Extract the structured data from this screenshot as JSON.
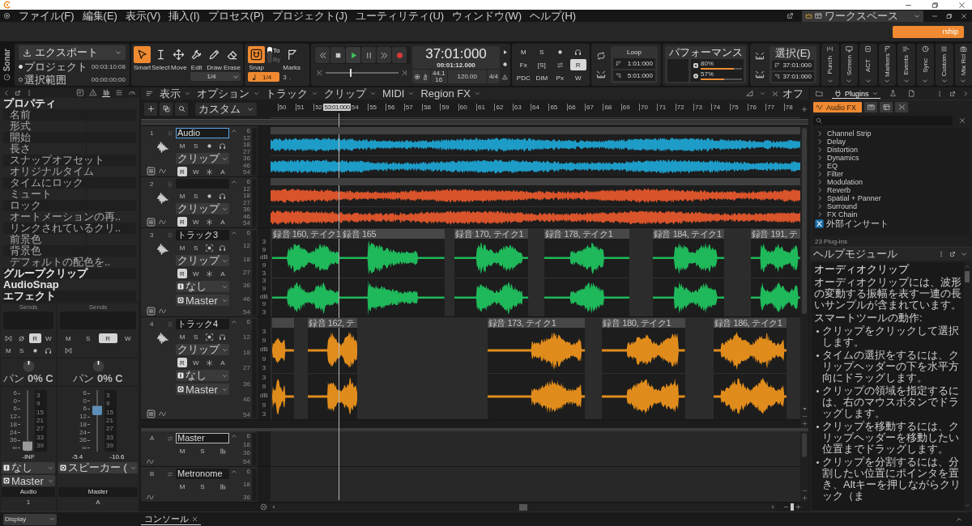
{
  "window": {
    "menu": [
      "ファイル(F)",
      "編集(E)",
      "表示(V)",
      "挿入(I)",
      "プロセス(P)",
      "プロジェクト(J)",
      "ユーティリティ(U)",
      "ウィンドウ(W)",
      "ヘルプ(H)"
    ],
    "workspace": "ワークスペース",
    "account_button": "rship"
  },
  "control_bar": {
    "logo": "Sonar",
    "export": {
      "button": "エクスポート",
      "ranges": [
        {
          "label": "プロジェクト",
          "time": "00:03:10:08",
          "selected": true
        },
        {
          "label": "選択範囲",
          "time": "00:00:00:00",
          "selected": false
        }
      ]
    },
    "tools": {
      "items": [
        {
          "kind": "smart",
          "label": "Smart",
          "selected": true
        },
        {
          "kind": "select",
          "label": "Select",
          "selected": false
        },
        {
          "kind": "move",
          "label": "Move",
          "selected": false
        },
        {
          "kind": "edit",
          "label": "Edit",
          "selected": false
        },
        {
          "kind": "draw",
          "label": "Draw",
          "selected": false
        },
        {
          "kind": "erase",
          "label": "Erase",
          "selected": false
        }
      ],
      "resolution": "1/4"
    },
    "snap": {
      "label": "Snap",
      "on": true,
      "modes": [
        {
          "label": "To",
          "selected": true
        },
        {
          "label": "By",
          "selected": false
        }
      ],
      "marks": "Marks",
      "value": "1/4",
      "modifiers": [
        "3",
        "."
      ]
    },
    "transport": {
      "buttons": [
        {
          "kind": "rewind",
          "on": false
        },
        {
          "kind": "stop",
          "on": false
        },
        {
          "kind": "play",
          "on": true
        },
        {
          "kind": "pause",
          "on": false
        },
        {
          "kind": "fast-forward",
          "on": false
        },
        {
          "kind": "record",
          "on": false
        }
      ],
      "position": {
        "level": 0.33
      },
      "time": "37:01:000",
      "time_secondary": "00:01:12.000",
      "sample_rate": "44.1",
      "bit_depth": "16",
      "tempo": "120.00",
      "meter": "4/4"
    },
    "mix": [
      {
        "kind": "text",
        "label": "M",
        "on": false
      },
      {
        "kind": "text",
        "label": "S",
        "on": false
      },
      {
        "kind": "record",
        "on": false
      },
      {
        "kind": "headphones",
        "on": false
      },
      {
        "kind": "text",
        "label": "Fx",
        "on": false
      },
      {
        "kind": "text",
        "label": "[S]",
        "on": false
      },
      {
        "kind": "swap",
        "on": false
      },
      {
        "kind": "text",
        "label": "R",
        "on": true
      },
      {
        "kind": "text",
        "label": "PDC",
        "on": false
      },
      {
        "kind": "text",
        "label": "DIM",
        "on": false
      },
      {
        "kind": "text",
        "label": "Px",
        "on": false
      },
      {
        "kind": "text",
        "label": "W",
        "on": false
      }
    ],
    "loop": {
      "title": "Loop",
      "start": "1:01:000",
      "end": "5:01:000"
    },
    "performance": {
      "title": "パフォーマンス",
      "meters": [
        {
          "reading": "80%",
          "level": 0.8
        },
        {
          "reading": "57%",
          "level": 0.57
        }
      ]
    },
    "selection": {
      "title": "選択(E)",
      "start": "37:01:000",
      "end": "37:01:000"
    },
    "views": [
      "Punch",
      "Screen",
      "ACT",
      "Markers",
      "Events",
      "Sync",
      "Custom",
      "Mix Rcl"
    ]
  },
  "inspector": {
    "tabs": [
      {
        "kind": "text-box",
        "selected": false
      },
      {
        "kind": "warning",
        "selected": false
      },
      {
        "kind": "bars",
        "selected": true
      },
      {
        "kind": "list",
        "selected": false
      },
      {
        "kind": "gauge",
        "selected": false
      }
    ],
    "properties": [
      {
        "kind": "header",
        "label": "プロパティ"
      },
      {
        "kind": "field",
        "label": "名前"
      },
      {
        "kind": "field",
        "label": "形式"
      },
      {
        "kind": "field",
        "label": "開始"
      },
      {
        "kind": "field",
        "label": "長さ"
      },
      {
        "kind": "field",
        "label": "スナップオフセット"
      },
      {
        "kind": "field",
        "label": "オリジナルタイム"
      },
      {
        "kind": "field",
        "label": "タイムにロック"
      },
      {
        "kind": "field",
        "label": "ミュート"
      },
      {
        "kind": "field",
        "label": "ロック"
      },
      {
        "kind": "field",
        "label": "オートメーションの再.."
      },
      {
        "kind": "field",
        "label": "リンクされているクリ.."
      },
      {
        "kind": "field",
        "label": "前景色"
      },
      {
        "kind": "field",
        "label": "背景色"
      },
      {
        "kind": "field",
        "label": "デフォルトの配色を.."
      },
      {
        "kind": "header",
        "label": "グループクリップ"
      },
      {
        "kind": "header",
        "label": "AudioSnap"
      },
      {
        "kind": "header",
        "label": "エフェクト"
      }
    ],
    "strips": [
      {
        "kind": "track",
        "sends": "Sends",
        "buttons": [
          {
            "kind": "link",
            "on": false
          },
          {
            "kind": "phase",
            "on": false
          },
          {
            "kind": "text",
            "label": "R",
            "on": true
          },
          {
            "kind": "text",
            "label": "W",
            "on": false
          },
          {
            "kind": "text",
            "label": "M",
            "on": false
          },
          {
            "kind": "text",
            "label": "S",
            "on": false
          },
          {
            "kind": "record",
            "on": false
          },
          {
            "kind": "headphones",
            "on": false
          }
        ],
        "pan": "パン **0% C**",
        "fader": {
          "level": 0.09
        },
        "scale": [
          "6",
          "0",
          "6",
          "12",
          "18",
          "24",
          "36",
          "∞"
        ],
        "meter_scale": [
          "3",
          "9",
          "15",
          "21",
          "27",
          "33",
          "39"
        ],
        "readings": [
          "-INF"
        ],
        "input": "なし",
        "output": "Master",
        "name": "Audio",
        "number": "1"
      },
      {
        "kind": "bus",
        "sends": "Sends",
        "buttons": [
          {
            "kind": "text",
            "label": "M",
            "on": false
          },
          {
            "kind": "text",
            "label": "S",
            "on": false
          },
          {
            "kind": "text",
            "label": "R",
            "on": true
          },
          {
            "kind": "text",
            "label": "W",
            "on": false
          },
          {
            "kind": "link",
            "on": false
          }
        ],
        "pan": "パン **0% C**",
        "fader": {
          "level": 0.67
        },
        "scale": [
          "6",
          "0",
          "6",
          "12",
          "18",
          "24",
          "36",
          "∞"
        ],
        "meter_scale": [
          "3",
          "9",
          "15",
          "21",
          "27",
          "33",
          "39"
        ],
        "readings": [
          "-5.4",
          "-10.6"
        ],
        "output": "スピーカー (",
        "name": "Master",
        "number": "A"
      }
    ]
  },
  "track_view": {
    "menus": [
      "表示",
      "オプション",
      "トラック",
      "クリップ",
      "MIDI",
      "Region FX"
    ],
    "snap_off": "オフ",
    "preset": "カスタム",
    "ruler": [
      {
        "kind": "bar",
        "label": "50"
      },
      {
        "kind": "bar",
        "label": "51"
      },
      {
        "kind": "bar",
        "label": "52"
      },
      {
        "kind": "marker",
        "label": "53:01:000"
      },
      {
        "kind": "bar",
        "label": "54"
      },
      {
        "kind": "bar",
        "label": "55"
      },
      {
        "kind": "bar",
        "label": "56"
      },
      {
        "kind": "bar",
        "label": "57"
      },
      {
        "kind": "bar",
        "label": "58"
      },
      {
        "kind": "bar",
        "label": "59"
      },
      {
        "kind": "bar",
        "label": "60"
      },
      {
        "kind": "bar",
        "label": "61"
      },
      {
        "kind": "bar",
        "label": "62"
      },
      {
        "kind": "bar",
        "label": "63"
      },
      {
        "kind": "bar",
        "label": "64"
      },
      {
        "kind": "bar",
        "label": "65"
      },
      {
        "kind": "bar",
        "label": "66"
      },
      {
        "kind": "bar",
        "label": "67"
      },
      {
        "kind": "bar",
        "label": "68"
      },
      {
        "kind": "bar",
        "label": "69"
      },
      {
        "kind": "bar",
        "label": "70"
      },
      {
        "kind": "bar",
        "label": "71"
      },
      {
        "kind": "bar",
        "label": "72"
      },
      {
        "kind": "bar",
        "label": "73"
      },
      {
        "kind": "bar",
        "label": "74"
      },
      {
        "kind": "bar",
        "label": "75"
      },
      {
        "kind": "bar",
        "label": "76"
      },
      {
        "kind": "bar",
        "label": "77"
      },
      {
        "kind": "bar",
        "label": "78"
      }
    ],
    "tracks": [
      {
        "number": "1",
        "name": "Audio",
        "name_selected": true,
        "color": "#1e9cc8",
        "record_focused": false,
        "buttons": [
          {
            "kind": "text",
            "label": "M",
            "on": false
          },
          {
            "kind": "text",
            "label": "S",
            "on": false
          },
          {
            "kind": "record",
            "on": false
          },
          {
            "kind": "headphones",
            "on": false
          }
        ],
        "mode": "クリップ",
        "automation": [
          {
            "kind": "text",
            "label": "R",
            "on": true
          },
          {
            "kind": "text",
            "label": "W",
            "on": false
          },
          {
            "kind": "asterisk",
            "on": false
          },
          {
            "kind": "text",
            "label": "A",
            "on": false
          }
        ],
        "meter_scale": [
          "6",
          "12",
          "18",
          "27",
          "36",
          "46",
          "54"
        ],
        "clips": [
          {
            "kind": "continuous"
          }
        ]
      },
      {
        "number": "2",
        "name_selected": false,
        "color": "#d9532b",
        "record_focused": false,
        "buttons": [
          {
            "kind": "text",
            "label": "M",
            "on": false
          },
          {
            "kind": "text",
            "label": "S",
            "on": false
          },
          {
            "kind": "record",
            "on": false
          },
          {
            "kind": "headphones",
            "on": false
          }
        ],
        "mode": "クリップ",
        "automation": [
          {
            "kind": "text",
            "label": "R",
            "on": true
          },
          {
            "kind": "text",
            "label": "W",
            "on": false
          },
          {
            "kind": "asterisk",
            "on": false
          },
          {
            "kind": "text",
            "label": "A",
            "on": false
          }
        ],
        "meter_scale": [
          "6",
          "12",
          "18",
          "27",
          "36",
          "46",
          "54"
        ],
        "clips": [
          {
            "kind": "continuous"
          }
        ]
      },
      {
        "number": "3",
        "name": "トラック3",
        "name_selected": false,
        "color": "#1fb85a",
        "record_focused": true,
        "buttons": [
          {
            "kind": "text",
            "label": "M",
            "on": false
          },
          {
            "kind": "text",
            "label": "S",
            "on": false
          },
          {
            "kind": "record",
            "on": false
          },
          {
            "kind": "headphones",
            "on": false
          }
        ],
        "mode": "クリップ",
        "automation": [
          {
            "kind": "text",
            "label": "R",
            "on": true
          },
          {
            "kind": "text",
            "label": "W",
            "on": false
          },
          {
            "kind": "asterisk",
            "on": false
          },
          {
            "kind": "text",
            "label": "A",
            "on": false
          }
        ],
        "input": "なし",
        "output": "Master",
        "meter_scale": [
          "6",
          "12",
          "18",
          "27",
          "36",
          "46",
          "54"
        ],
        "db_scale": [
          "3",
          "9",
          "dB",
          "9",
          "3",
          "3",
          "9",
          "dB",
          "9",
          "3"
        ],
        "clips": [
          {
            "kind": "take",
            "title": "録音 160, テイク1"
          },
          {
            "kind": "take",
            "title": "録音 165"
          },
          {
            "kind": "take",
            "title": "録音 170, テイク1"
          },
          {
            "kind": "take",
            "title": "録音 178, テイク1"
          },
          {
            "kind": "take",
            "title": "録音 184, テイク1"
          },
          {
            "kind": "take",
            "title": "録音 191, テ"
          }
        ]
      },
      {
        "number": "4",
        "name": "トラック4",
        "name_selected": false,
        "color": "#e08c1c",
        "record_focused": true,
        "buttons": [
          {
            "kind": "text",
            "label": "M",
            "on": false
          },
          {
            "kind": "text",
            "label": "S",
            "on": false
          },
          {
            "kind": "record",
            "on": false
          },
          {
            "kind": "headphones",
            "on": false
          }
        ],
        "mode": "クリップ",
        "automation": [
          {
            "kind": "text",
            "label": "R",
            "on": true
          },
          {
            "kind": "text",
            "label": "W",
            "on": false
          },
          {
            "kind": "asterisk",
            "on": false
          },
          {
            "kind": "text",
            "label": "A",
            "on": false
          }
        ],
        "input": "なし",
        "output": "Master",
        "meter_scale": [
          "6",
          "12",
          "18",
          "27",
          "36",
          "46",
          "54"
        ],
        "db_scale": [
          "3",
          "9",
          "dB",
          "9",
          "3",
          "3",
          "9",
          "dB",
          "9",
          "3"
        ],
        "clips": [
          {
            "kind": "take"
          },
          {
            "kind": "take",
            "title": "録音 162, テ"
          },
          {
            "kind": "take",
            "title": "録音 173, テイク1"
          },
          {
            "kind": "take",
            "title": "録音 180, テイク1"
          },
          {
            "kind": "take",
            "title": "録音 186, テイク1"
          }
        ]
      }
    ],
    "buses": [
      {
        "letter": "A",
        "name": "Master",
        "name_focused": true,
        "buttons": [
          {
            "kind": "text",
            "label": "M",
            "on": false
          },
          {
            "kind": "text",
            "label": "S",
            "on": false
          },
          {
            "kind": "meter",
            "on": false
          }
        ],
        "meter_scale": [
          "6",
          "18",
          "36",
          "54"
        ]
      },
      {
        "letter": "B",
        "name": "Metronome",
        "name_focused": false,
        "buttons": [
          {
            "kind": "text",
            "label": "M",
            "on": false
          },
          {
            "kind": "text",
            "label": "S",
            "on": false
          },
          {
            "kind": "meter",
            "on": false
          }
        ],
        "meter_scale": [
          "6",
          "18",
          "36"
        ]
      }
    ]
  },
  "browser": {
    "tabs": [
      {
        "kind": "folder",
        "selected": false
      },
      {
        "kind": "plugins",
        "label": "Plugins",
        "selected": true
      },
      {
        "kind": "flask",
        "selected": false
      },
      {
        "kind": "document",
        "selected": false
      }
    ],
    "filters": [
      {
        "kind": "audio-fx",
        "label": "Audio FX",
        "selected": true
      },
      {
        "kind": "midi",
        "selected": false
      },
      {
        "kind": "instrument",
        "selected": false
      },
      {
        "kind": "chain",
        "selected": false
      }
    ],
    "categories": [
      {
        "kind": "folder",
        "label": "Channel Strip"
      },
      {
        "kind": "folder",
        "label": "Delay"
      },
      {
        "kind": "folder",
        "label": "Distortion"
      },
      {
        "kind": "folder",
        "label": "Dynamics"
      },
      {
        "kind": "folder",
        "label": "EQ"
      },
      {
        "kind": "folder",
        "label": "Filter"
      },
      {
        "kind": "folder",
        "label": "Modulation"
      },
      {
        "kind": "folder",
        "label": "Reverb"
      },
      {
        "kind": "folder",
        "label": "Spatial + Panner"
      },
      {
        "kind": "folder",
        "label": "Surround"
      },
      {
        "kind": "folder",
        "label": "FX Chain"
      },
      {
        "kind": "plugin",
        "label": "外部インサート"
      }
    ],
    "count": "23 Plug-ins"
  },
  "help": {
    "title": "ヘルプモジュール",
    "heading": "オーディオクリップ",
    "intro": "オーディオクリップには、波形の変動する振幅を表す一連の長いサンプルが含まれています。",
    "subheading": "スマートツールの動作:",
    "bullets": [
      "クリップをクリックして選択します。",
      "タイムの選択をするには、クリップヘッダーの下を水平方向にドラッグします。",
      "クリップの領域を指定するには、右のマウスボタンでドラッグします。",
      "クリップを移動するには、クリップヘッダーを移動したい位置までドラッグします。",
      "クリップを分割するには、分割したい位置にポインタを置き、Altキーを押しながらクリック（ま"
    ]
  },
  "bottom_bar": {
    "display": "Display",
    "tabs": [
      {
        "label": "コンソール",
        "selected": true
      }
    ]
  }
}
